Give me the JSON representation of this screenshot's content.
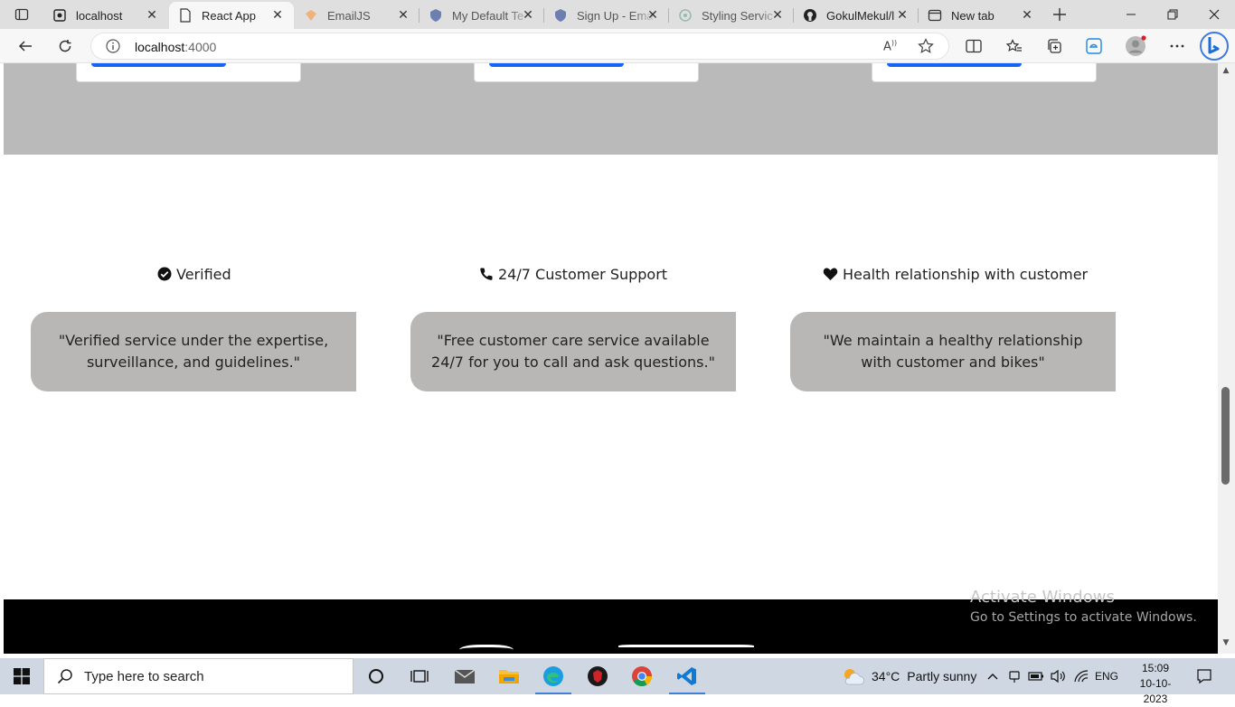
{
  "browser": {
    "tabs": [
      {
        "title": "localhost",
        "icon": "github-icon"
      },
      {
        "title": "React App",
        "icon": "page-icon"
      },
      {
        "title": "EmailJS",
        "icon": "emailjs-icon"
      },
      {
        "title": "My Default Te",
        "icon": "shield-icon"
      },
      {
        "title": "Sign Up - Ema",
        "icon": "shield-icon"
      },
      {
        "title": "Styling Servic",
        "icon": "chatgpt-icon"
      },
      {
        "title": "GokulMekul/l",
        "icon": "github-icon"
      },
      {
        "title": "New tab",
        "icon": "newtab-icon"
      }
    ],
    "address": {
      "host": "localhost",
      "port": ":4000"
    }
  },
  "features": [
    {
      "title": "Verified",
      "icon": "check-circle-icon",
      "description": "\"Verified service under the expertise, surveillance, and guidelines.\""
    },
    {
      "title": "24/7 Customer Support",
      "icon": "phone-icon",
      "description": "\"Free customer care service available 24/7 for you to call and ask questions.\""
    },
    {
      "title": "Health relationship with customer",
      "icon": "heart-icon",
      "description": "\"We maintain a healthy relationship with customer and bikes\""
    }
  ],
  "watermark": {
    "line1": "Activate Windows",
    "line2": "Go to Settings to activate Windows."
  },
  "taskbar": {
    "search_placeholder": "Type here to search",
    "weather": {
      "temp": "34°C",
      "condition": "Partly sunny"
    },
    "language": "ENG",
    "time": "15:09",
    "date": "10-10-2023"
  },
  "colors": {
    "band": "#bbbaba",
    "card": "#b8b7b6",
    "button_blue": "#1565f5",
    "footer": "#000000"
  }
}
